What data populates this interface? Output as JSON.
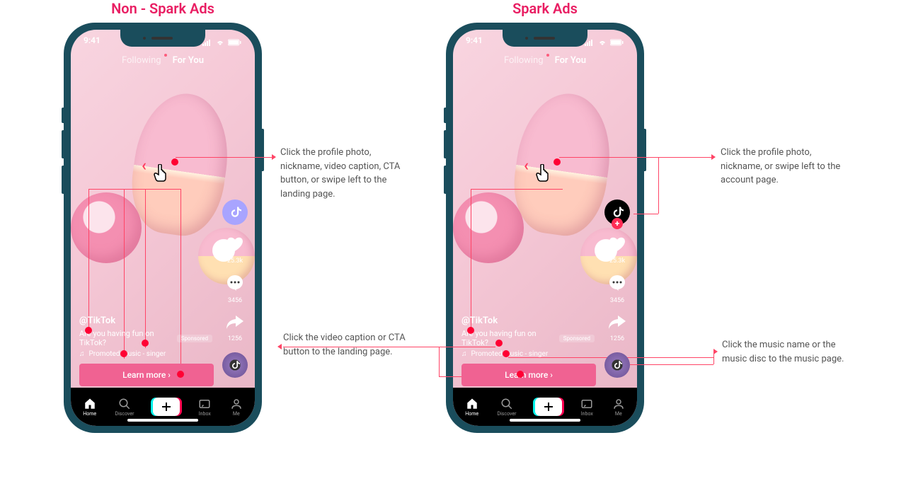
{
  "titles": {
    "nonSpark": "Non - Spark Ads",
    "spark": "Spark Ads"
  },
  "statusBar": {
    "time": "9:41"
  },
  "tabs": {
    "following": "Following",
    "forYou": "For You"
  },
  "rail": {
    "likes": "25.3k",
    "comments": "3456",
    "shares": "1256"
  },
  "content": {
    "nickname": "@TikTok",
    "caption": "Are you having fun on TikTok?",
    "sponsored": "Sponsored",
    "music": "Promoted music - singer",
    "cta": "Learn more",
    "ctaChevron": "›"
  },
  "nav": {
    "home": "Home",
    "discover": "Discover",
    "inbox": "Inbox",
    "me": "Me"
  },
  "annotations": {
    "nonSparkMain": "Click the profile photo, nickname, video caption, CTA button, or swipe left to the landing page.",
    "sparkProfile": "Click the profile photo, nickname, or swipe left to the account page.",
    "sparkCaption": "Click the video caption or CTA button to the landing page.",
    "sparkMusic": "Click the music name or the music disc to the music page."
  }
}
